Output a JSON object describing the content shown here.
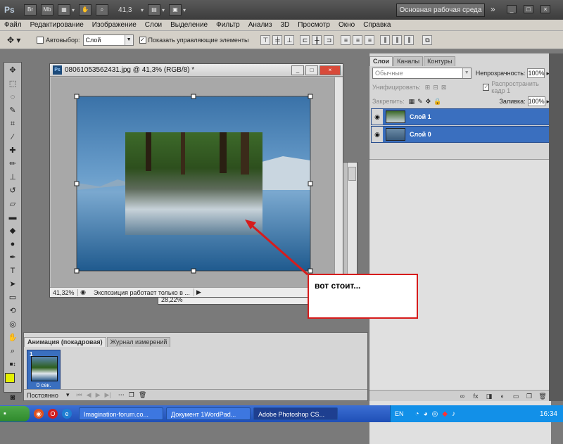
{
  "appbar": {
    "logo": "Ps",
    "btn_br": "Br",
    "btn_mb": "Mb",
    "zoom": "41,3",
    "workspace": "Основная рабочая среда"
  },
  "menu": [
    "Файл",
    "Редактирование",
    "Изображение",
    "Слои",
    "Выделение",
    "Фильтр",
    "Анализ",
    "3D",
    "Просмотр",
    "Окно",
    "Справка"
  ],
  "options": {
    "autoselect_label": "Автовыбор:",
    "autoselect_value": "Слой",
    "show_controls_label": "Показать управляющие элементы"
  },
  "doc1": {
    "title": "08061053562431.jpg @ 41,3% (RGB/8) *",
    "zoom": "41,32%",
    "status": "Экспозиция работает только в ..."
  },
  "doc2": {
    "zoom": "28,22%"
  },
  "layers_panel": {
    "tabs": [
      "Слои",
      "Каналы",
      "Контуры"
    ],
    "blend_mode": "Обычные",
    "opacity_label": "Непрозрачность:",
    "opacity_value": "100%",
    "unify_label": "Унифицировать:",
    "propagate_label": "Распространить кадр 1",
    "lock_label": "Закрепить:",
    "fill_label": "Заливка:",
    "fill_value": "100%",
    "layers": [
      {
        "name": "Слой 1"
      },
      {
        "name": "Слой 0"
      }
    ]
  },
  "animation_panel": {
    "tabs": [
      "Анимация (покадровая)",
      "Журнал измерений"
    ],
    "frame_number": "1",
    "frame_duration": "0 сек.",
    "loop": "Постоянно"
  },
  "callout": {
    "text": "вот стоит..."
  },
  "taskbar": {
    "tasks": [
      "Imagination-forum.co...",
      "Документ 1WordPad...",
      "Adobe Photoshop CS..."
    ],
    "lang": "EN",
    "clock": "16:34"
  }
}
